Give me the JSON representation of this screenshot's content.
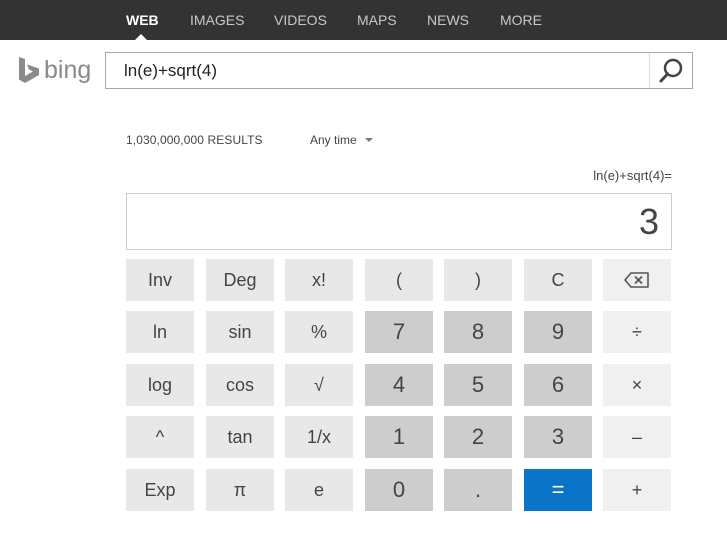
{
  "nav": {
    "tabs": [
      {
        "label": "WEB"
      },
      {
        "label": "IMAGES"
      },
      {
        "label": "VIDEOS"
      },
      {
        "label": "MAPS"
      },
      {
        "label": "NEWS"
      },
      {
        "label": "MORE"
      }
    ]
  },
  "logo": {
    "text": "bing"
  },
  "search": {
    "query": "ln(e)+sqrt(4)"
  },
  "results": {
    "count": "1,030,000,000 RESULTS",
    "time_filter": "Any time"
  },
  "calculator": {
    "expression": "ln(e)+sqrt(4)=",
    "display": "3",
    "keys": [
      [
        "Inv",
        "Deg",
        "x!",
        "(",
        ")",
        "C",
        ""
      ],
      [
        "ln",
        "sin",
        "%",
        "7",
        "8",
        "9",
        "÷"
      ],
      [
        "log",
        "cos",
        "√",
        "4",
        "5",
        "6",
        "×"
      ],
      [
        "^",
        "tan",
        "1/x",
        "1",
        "2",
        "3",
        "–"
      ],
      [
        "Exp",
        "π",
        "e",
        "0",
        ".",
        "=",
        "+"
      ]
    ]
  },
  "colors": {
    "nav_bg": "#333333",
    "equals_bg": "#0a74c9",
    "logo": "#8a8a8a"
  }
}
